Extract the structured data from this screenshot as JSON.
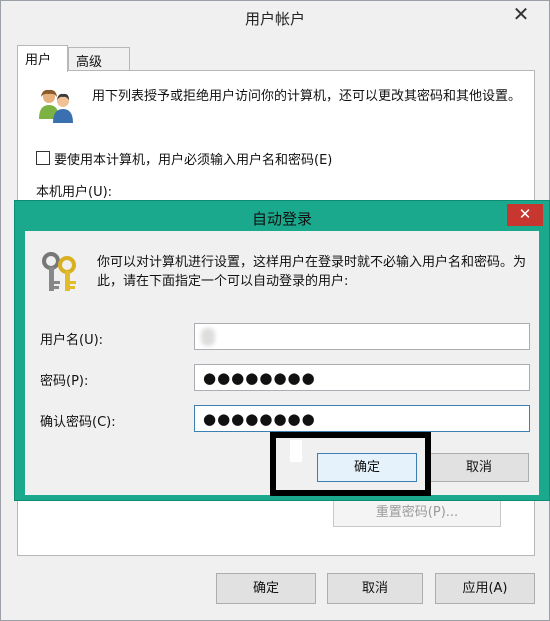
{
  "outer": {
    "title": "用户帐户",
    "close_glyph": "✕",
    "tabs": [
      "用户",
      "高级"
    ],
    "intro": "用下列表授予或拒绝用户访问你的计算机，还可以更改其密码和其他设置。",
    "require_login_checkbox": {
      "label": "要使用本计算机，用户必须输入用户名和密码(E)",
      "checked": false
    },
    "local_users_label": "本机用户(U):",
    "reset_password_button": "重置密码(P)...",
    "buttons": {
      "ok": "确定",
      "cancel": "取消",
      "apply": "应用(A)"
    }
  },
  "dialog": {
    "title": "自动登录",
    "close_glyph": "✕",
    "message": "你可以对计算机进行设置，这样用户在登录时就不必输入用户名和密码。为此，请在下面指定一个可以自动登录的用户:",
    "fields": {
      "username": {
        "label": "用户名(U):",
        "value": ""
      },
      "password": {
        "label": "密码(P):",
        "value": "●●●●●●●●"
      },
      "confirm": {
        "label": "确认密码(C):",
        "value": "●●●●●●●●"
      }
    },
    "buttons": {
      "ok": "确定",
      "cancel": "取消"
    },
    "accent_color": "#1aa98c",
    "close_color": "#c7372f"
  },
  "icons": {
    "users": "users-icon",
    "keys": "keys-icon"
  }
}
